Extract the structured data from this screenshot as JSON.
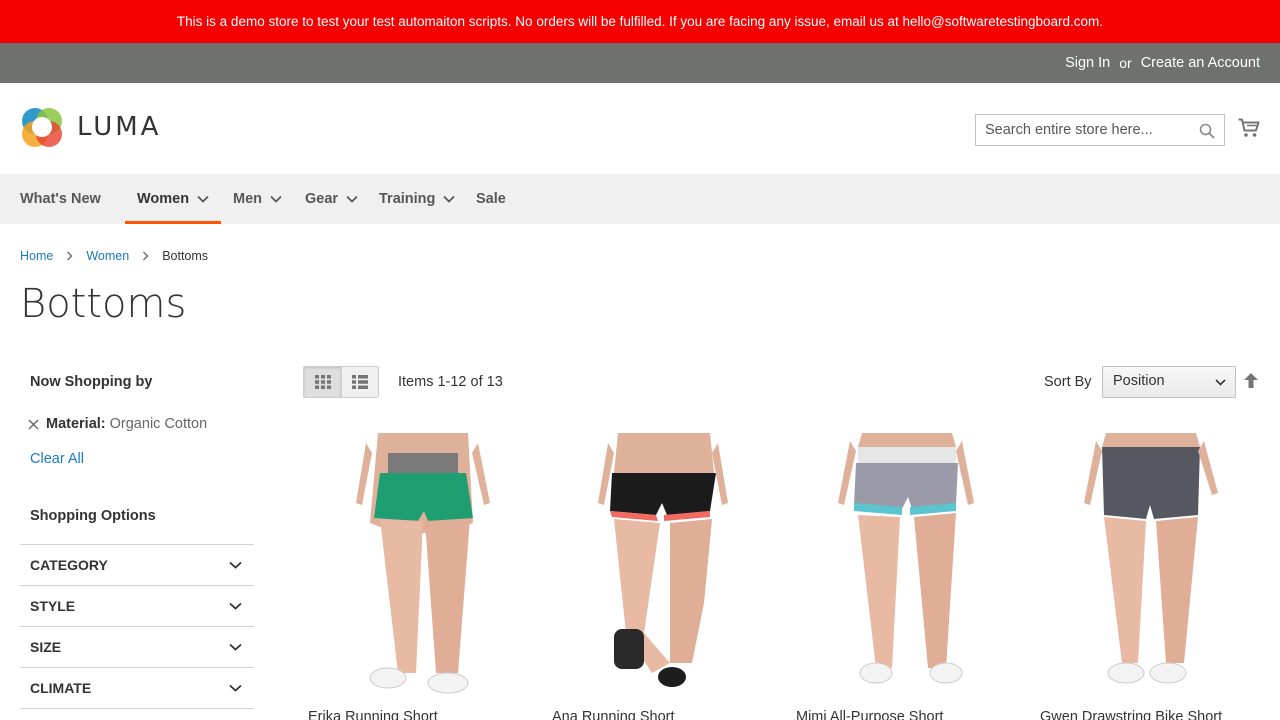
{
  "banner": {
    "text": "This is a demo store to test your test automaiton scripts. No orders will be fulfilled. If you are facing any issue, email us at hello@softwaretestingboard.com."
  },
  "topbar": {
    "sign_in": "Sign In",
    "or": "or",
    "create_account": "Create an Account"
  },
  "header": {
    "logo_text": "LUMA",
    "search_placeholder": "Search entire store here..."
  },
  "nav": [
    {
      "label": "What's New"
    },
    {
      "label": "Women"
    },
    {
      "label": "Men"
    },
    {
      "label": "Gear"
    },
    {
      "label": "Training"
    },
    {
      "label": "Sale"
    }
  ],
  "breadcrumb": {
    "home": "Home",
    "women": "Women",
    "current": "Bottoms"
  },
  "page_title": "Bottoms",
  "sidebar": {
    "now_shopping": "Now Shopping by",
    "filter_label": "Material:",
    "filter_value": "Organic Cotton",
    "clear_all": "Clear All",
    "shopping_options": "Shopping Options",
    "options": [
      "CATEGORY",
      "STYLE",
      "SIZE",
      "CLIMATE"
    ]
  },
  "toolbar": {
    "amount": "Items 1-12 of 13",
    "sort_label": "Sort By",
    "sort_value": "Position"
  },
  "products": [
    {
      "name": "Erika Running Short"
    },
    {
      "name": "Ana Running Short"
    },
    {
      "name": "Mimi All-Purpose Short"
    },
    {
      "name": "Gwen Drawstring Bike Short"
    }
  ],
  "colors": {
    "banner": "#f40000",
    "topbar": "#6e716e",
    "nav": "#f0f0f0",
    "accent": "#ff5501",
    "link": "#1979c3"
  }
}
